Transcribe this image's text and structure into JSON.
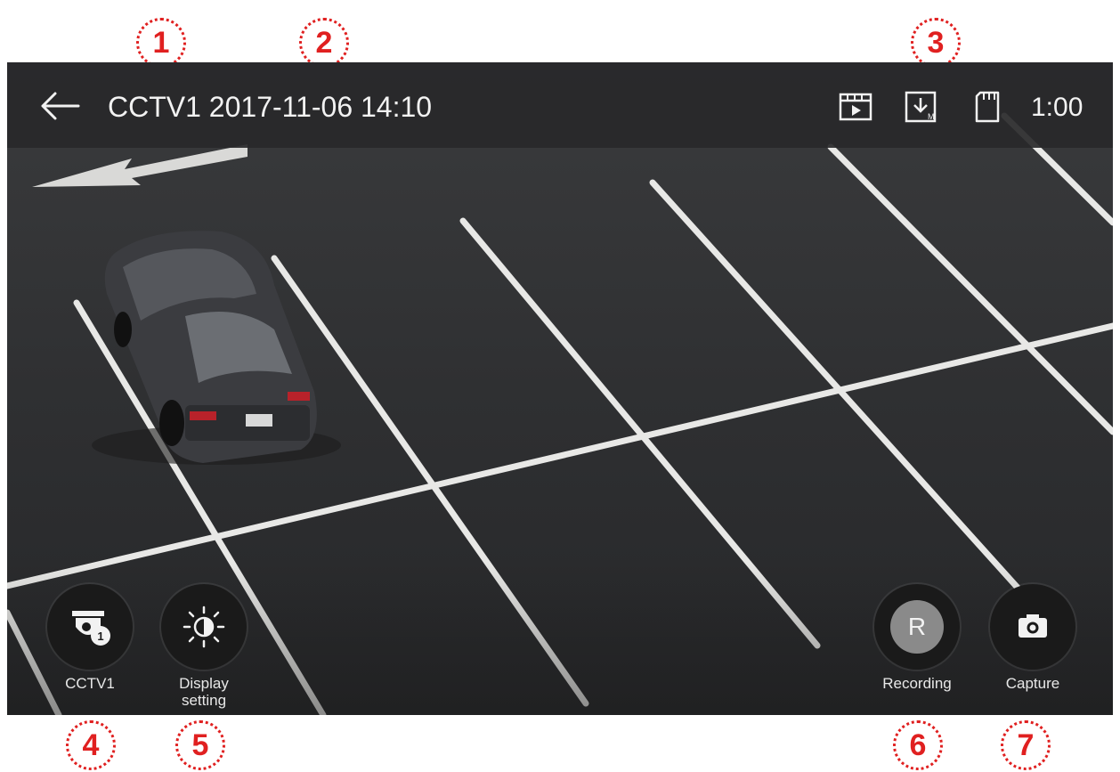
{
  "callouts": [
    "1",
    "2",
    "3",
    "4",
    "5",
    "6",
    "7"
  ],
  "header": {
    "title": "CCTV1 2017-11-06 14:10",
    "time": "1:00",
    "icons": [
      "back-arrow-icon",
      "video-playback-icon",
      "download-icon",
      "sd-card-icon"
    ]
  },
  "controls": {
    "cctv_label": "CCTV1",
    "cctv_badge": "1",
    "display_label_line1": "Display",
    "display_label_line2": "setting",
    "record_letter": "R",
    "record_label": "Recording",
    "capture_label": "Capture"
  },
  "colors": {
    "callout": "#e02020",
    "topbar": "#2b2b2d",
    "record_button": "#8a8a8a"
  }
}
